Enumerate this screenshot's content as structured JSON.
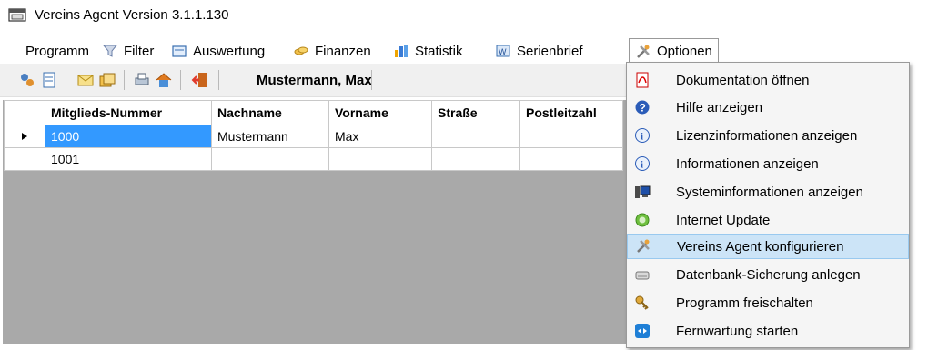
{
  "window": {
    "title": "Vereins Agent Version 3.1.1.130"
  },
  "menu": [
    {
      "label": "Programm",
      "icon": "none"
    },
    {
      "label": "Filter",
      "icon": "filter-icon"
    },
    {
      "label": "Auswertung",
      "icon": "report-icon"
    },
    {
      "label": "Finanzen",
      "icon": "money-icon"
    },
    {
      "label": "Statistik",
      "icon": "chart-icon"
    },
    {
      "label": "Serienbrief",
      "icon": "letter-icon"
    },
    {
      "label": "Optionen",
      "icon": "tools-icon"
    }
  ],
  "toolbar": {
    "current_member": "Mustermann, Max"
  },
  "table": {
    "columns": [
      "Mitglieds-Nummer",
      "Nachname",
      "Vorname",
      "Straße",
      "Postleitzahl"
    ],
    "rows": [
      [
        "1000",
        "Mustermann",
        "Max",
        "",
        ""
      ],
      [
        "1001",
        "",
        "",
        "",
        ""
      ]
    ]
  },
  "optionen_menu": {
    "items": [
      {
        "label": "Dokumentation öffnen",
        "icon": "pdf-icon"
      },
      {
        "label": "Hilfe anzeigen",
        "icon": "help-icon"
      },
      {
        "label": "Lizenzinformationen anzeigen",
        "icon": "info-icon"
      },
      {
        "label": "Informationen anzeigen",
        "icon": "info-icon"
      },
      {
        "label": "Systeminformationen anzeigen",
        "icon": "computer-icon"
      },
      {
        "label": "Internet Update",
        "icon": "update-icon"
      },
      {
        "label": "Vereins Agent  konfigurieren",
        "icon": "tools-icon",
        "highlighted": true
      },
      {
        "label": "Datenbank-Sicherung anlegen",
        "icon": "drive-icon"
      },
      {
        "label": "Programm freischalten",
        "icon": "key-icon"
      },
      {
        "label": "Fernwartung starten",
        "icon": "remote-icon"
      }
    ]
  },
  "colors": {
    "selection": "#3399ff",
    "menu_highlight": "#cce4f7",
    "grid_background": "#a9a9a9"
  }
}
